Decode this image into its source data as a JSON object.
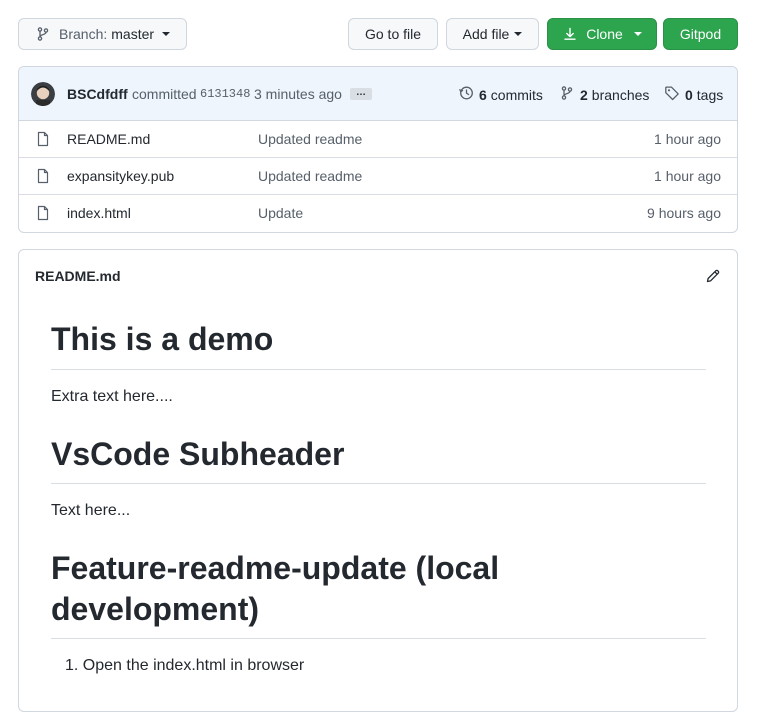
{
  "toolbar": {
    "branch_label": "Branch:",
    "branch_value": "master",
    "goto_file": "Go to file",
    "add_file": "Add file",
    "clone": "Clone",
    "gitpod": "Gitpod"
  },
  "commit": {
    "author": "BSCdfdff",
    "verb": "committed",
    "sha": "6131348",
    "time": "3 minutes ago",
    "ellipsis": "…",
    "commits_count": "6",
    "commits_label": "commits",
    "branches_count": "2",
    "branches_label": "branches",
    "tags_count": "0",
    "tags_label": "tags"
  },
  "files": [
    {
      "name": "README.md",
      "message": "Updated readme",
      "age": "1 hour ago",
      "icon": "file-icon"
    },
    {
      "name": "expansitykey.pub",
      "message": "Updated readme",
      "age": "1 hour ago",
      "icon": "file-icon"
    },
    {
      "name": "index.html",
      "message": "Update",
      "age": "9 hours ago",
      "icon": "file-icon"
    }
  ],
  "readme": {
    "filename": "README.md",
    "h1_a": "This is a demo",
    "p_a": "Extra text here....",
    "h1_b": "VsCode Subheader",
    "p_b": "Text here...",
    "h1_c": "Feature-readme-update (local development)",
    "li_a": "1. Open the index.html in browser"
  },
  "colors": {
    "primary_green": "#2da44e",
    "commit_bar": "#eef5fc",
    "border": "#d0d7de",
    "muted_text": "#57606a"
  }
}
